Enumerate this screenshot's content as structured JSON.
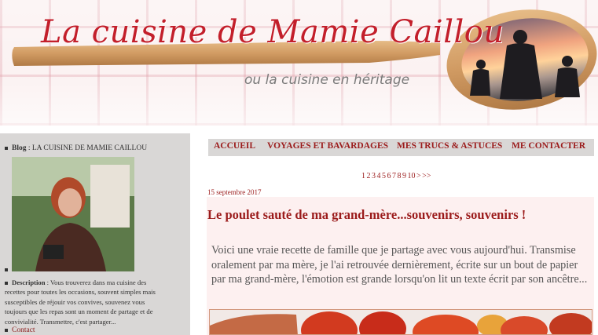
{
  "header": {
    "title": "La cuisine de Mamie Caillou",
    "subtitle": "ou la cuisine en héritage"
  },
  "sidebar": {
    "blog_label": "Blog",
    "blog_value": " : LA CUISINE DE MAMIE CAILLOU",
    "description_label": "Description",
    "description_text": " : Vous trouverez dans ma cuisine des recettes pour toutes les occasions, souvent simples mais susceptibles de réjouir vos convives, souvenez vous toujours que les repas sont un moment de partage et de convivialité. Transmettre, c'est partager...",
    "contact_label": "Contact"
  },
  "nav": {
    "items": [
      "Accueil",
      "Voyages et bavardages",
      "Mes trucs & astuces",
      "Me contacter"
    ]
  },
  "pager": {
    "pages": [
      "1",
      "2",
      "3",
      "4",
      "5",
      "6",
      "7",
      "8",
      "9",
      "10",
      ">",
      ">>"
    ]
  },
  "post": {
    "date": "15 septembre 2017",
    "title": "Le poulet sauté de ma grand-mère...souvenirs, souvenirs !",
    "excerpt": "Voici une vraie recette de famille que je partage avec vous aujourd'hui. Transmise oralement par ma mère, je l'ai retrouvée dernièrement, écrite sur un bout de papier par ma grand-mère, l'émotion est grande lorsqu'on lit un texte écrit par son ancêtre..."
  },
  "colors": {
    "accent": "#9b1b1b",
    "title_red": "#c31f2b",
    "nav_bg": "#d9d7d6",
    "post_bg": "#fdf0f0"
  }
}
